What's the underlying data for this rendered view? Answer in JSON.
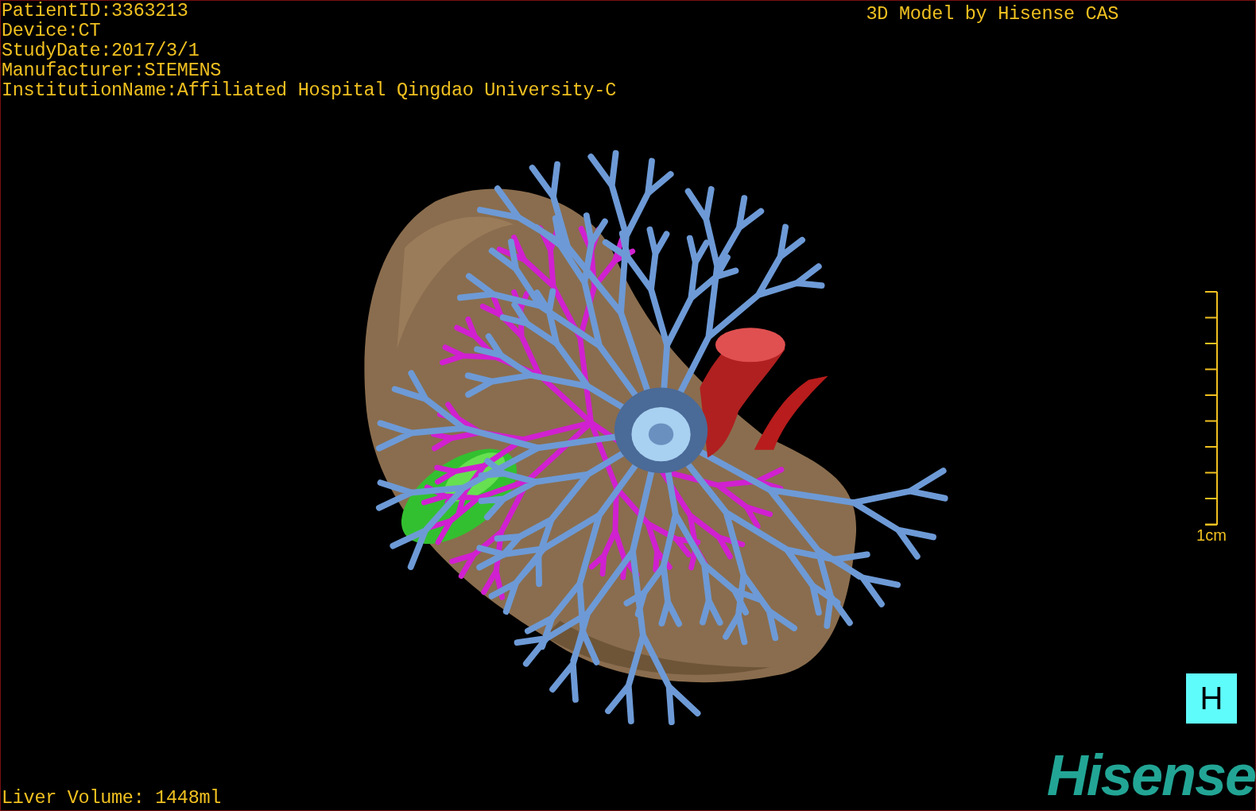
{
  "info": [
    "PatientID:3363213",
    "Device:CT",
    "StudyDate:2017/3/1",
    "Manufacturer:SIEMENS",
    "InstitutionName:Affiliated Hospital Qingdao University-C"
  ],
  "title": "3D Model by Hisense CAS",
  "scale": {
    "label": "1cm"
  },
  "view_button": {
    "label": "H"
  },
  "liver_volume": "Liver Volume: 1448ml",
  "logo": "Hisense"
}
